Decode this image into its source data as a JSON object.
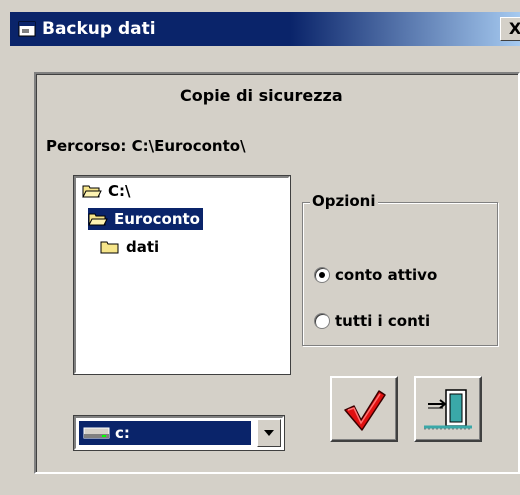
{
  "window": {
    "title": "Backup dati",
    "close_label": "X"
  },
  "panel": {
    "heading": "Copie di sicurezza",
    "path_label": "Percorso:",
    "path_value": "C:\\Euroconto\\"
  },
  "tree": {
    "items": [
      {
        "label": "C:\\",
        "state": "open",
        "selected": false
      },
      {
        "label": "Euroconto",
        "state": "open",
        "selected": true
      },
      {
        "label": "dati",
        "state": "closed",
        "selected": false
      }
    ]
  },
  "options": {
    "title": "Opzioni",
    "radios": [
      {
        "label": "conto attivo",
        "checked": true
      },
      {
        "label": "tutti i conti",
        "checked": false
      }
    ]
  },
  "drive": {
    "selected": "c:"
  },
  "buttons": {
    "confirm_icon": "checkmark-icon",
    "exit_icon": "exit-door-icon"
  },
  "colors": {
    "titlebar": "#0a246a",
    "selection": "#0a246a",
    "face": "#d4d0c8",
    "check_red": "#e01010"
  }
}
